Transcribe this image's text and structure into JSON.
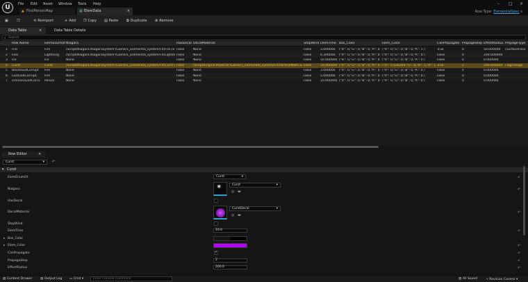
{
  "app": {
    "logo": "U",
    "menu": [
      "File",
      "Edit",
      "Asset",
      "Window",
      "Tools",
      "Help"
    ],
    "tabs": [
      {
        "label": "FirstPersonMap"
      },
      {
        "label": "ElemData",
        "close": "×"
      }
    ],
    "row_type_label": "Row Type:",
    "row_type_value": "ElementalSpec"
  },
  "toolbar": {
    "reimport": "Reimport",
    "add": "Add",
    "copy": "Copy",
    "paste": "Paste",
    "duplicate": "Duplicate",
    "remove": "Remove"
  },
  "panel_tabs": {
    "data_table": "Data Table",
    "close": "×",
    "details": "Data Table Details"
  },
  "search": {
    "placeholder": "Search"
  },
  "table": {
    "headers": [
      "Row Name",
      "ElemEnumOt",
      "Niagara",
      "HasDecal",
      "DecalMaterial",
      "StopWind",
      "ElemTime",
      "Bas_Color",
      "Elem_Color",
      "CanPropagate",
      "PropageStep",
      "EffectRadius",
      "PropageType"
    ],
    "rows": [
      [
        "1",
        "Fire",
        "Fire",
        "/Script/Niagara.NiagaraSystem'/Game/1_Elemental_system/FX/Fire.Fire'",
        "False",
        "None",
        "False",
        "3.000000",
        "(\"R\": 0,\"G\": 0,\"B\": 0,\"A\": 0 )",
        "(\"R\": 0,\"G\": 0,\"B\": 0,\"A\": 1 )",
        "True",
        "0",
        "50.000000",
        "(SurfaceFolio"
      ],
      [
        "2",
        "Elec",
        "Lightning",
        "/Script/Niagara.NiagaraSystem'/Game/1_Elemental_system/FX/Lightnin",
        "False",
        "None",
        "False",
        "0.300000",
        "(\"R\": 0,\"G\": 0,\"B\": 0,\"A\": 0 )",
        "(\"R\": 0,\"G\": 0,\"B\": 0,\"A\": 0 )",
        "False",
        "0",
        "200.000000",
        ""
      ],
      [
        "3",
        "Ice",
        "Ice",
        "None",
        "False",
        "None",
        "False",
        "10.000000",
        "(\"R\": 0,\"G\": 0,\"B\": 0,\"A\": 0 )",
        "(\"R\": 0,\"G\": 0,\"B\": 0,\"A\": 0 )",
        "False",
        "0",
        "0.000000",
        ""
      ],
      [
        "4",
        "Curst",
        "Curst",
        "/Script/Niagara.NiagaraSystem'/Game/1_Elemental_system/FX/Curst.Cu",
        "False",
        "/Script/Engine.Material'/Game/1_Elemental_system/FX/ParticleMat/Cur",
        "False",
        "10.000000",
        "(\"R\": 0,\"G\": 0,\"B\": 0,\"A\": 0 )",
        "(\"R\": 0.436264,\"G\": 0,\"B\": 1,\"A\": 1 )",
        "True",
        "2",
        "200.000000",
        "(TagFoliage"
      ],
      [
        "5",
        "BloodGodCorrupt",
        "Fire",
        "None",
        "False",
        "None",
        "False",
        "3.000000",
        "(\"R\": 0,\"G\": 0,\"B\": 0,\"A\": 0 )",
        "(\"R\": 0,\"G\": 0,\"B\": 0,\"A\": 0 )",
        "False",
        "0",
        "0.000000",
        ""
      ],
      [
        "6",
        "LustGodCorrupt",
        "Fire",
        "None",
        "False",
        "None",
        "False",
        "5.000000",
        "(\"R\": 0,\"G\": 0,\"B\": 0,\"A\": 0 )",
        "(\"R\": 0,\"G\": 0,\"B\": 0,\"A\": 0 )",
        "False",
        "0",
        "0.000000",
        ""
      ],
      [
        "7",
        "sicknessGodCorru",
        "Poison",
        "None",
        "False",
        "None",
        "False",
        "10.000000",
        "(\"R\": 0,\"G\": 0,\"B\": 0,\"A\": 0 )",
        "(\"R\": 0,\"G\": 0,\"B\": 0,\"A\": 0 )",
        "False",
        "0",
        "0.000000",
        ""
      ]
    ],
    "selected_row": 3
  },
  "row_editor": {
    "tab": "Row Editor",
    "close": "×",
    "selected": "Curst",
    "category": "Curst",
    "props": {
      "elem_enum_label": "ElemEnumOt",
      "elem_enum_value": "Curst",
      "niagara_label": "Niagara",
      "niagara_value": "Curst",
      "has_decal_label": "HasDecal",
      "decal_label": "DecalMaterial",
      "decal_value": "CurstDecal",
      "stop_wind_label": "StopWind",
      "elem_time_label": "ElemTime",
      "elem_time_value": "10.0",
      "bas_color_label": "Bas_Color",
      "elem_color_label": "Elem_Color",
      "can_propagate_label": "CanPropagate",
      "propage_step_label": "PropageStep",
      "propage_step_value": "2",
      "effect_radius_label": "EffectRadius",
      "effect_radius_value": "200.0"
    },
    "colors": {
      "elem_color": "#b400ff",
      "accent": "#2aa6c9",
      "selection": "#5a4a1c"
    }
  },
  "status": {
    "content_drawer": "Content Drawer",
    "output_log": "Output Log",
    "cmd": "Cmd",
    "console_placeholder": "Enter Console Command",
    "all_saved": "All Saved",
    "revision": "Revision Control"
  }
}
